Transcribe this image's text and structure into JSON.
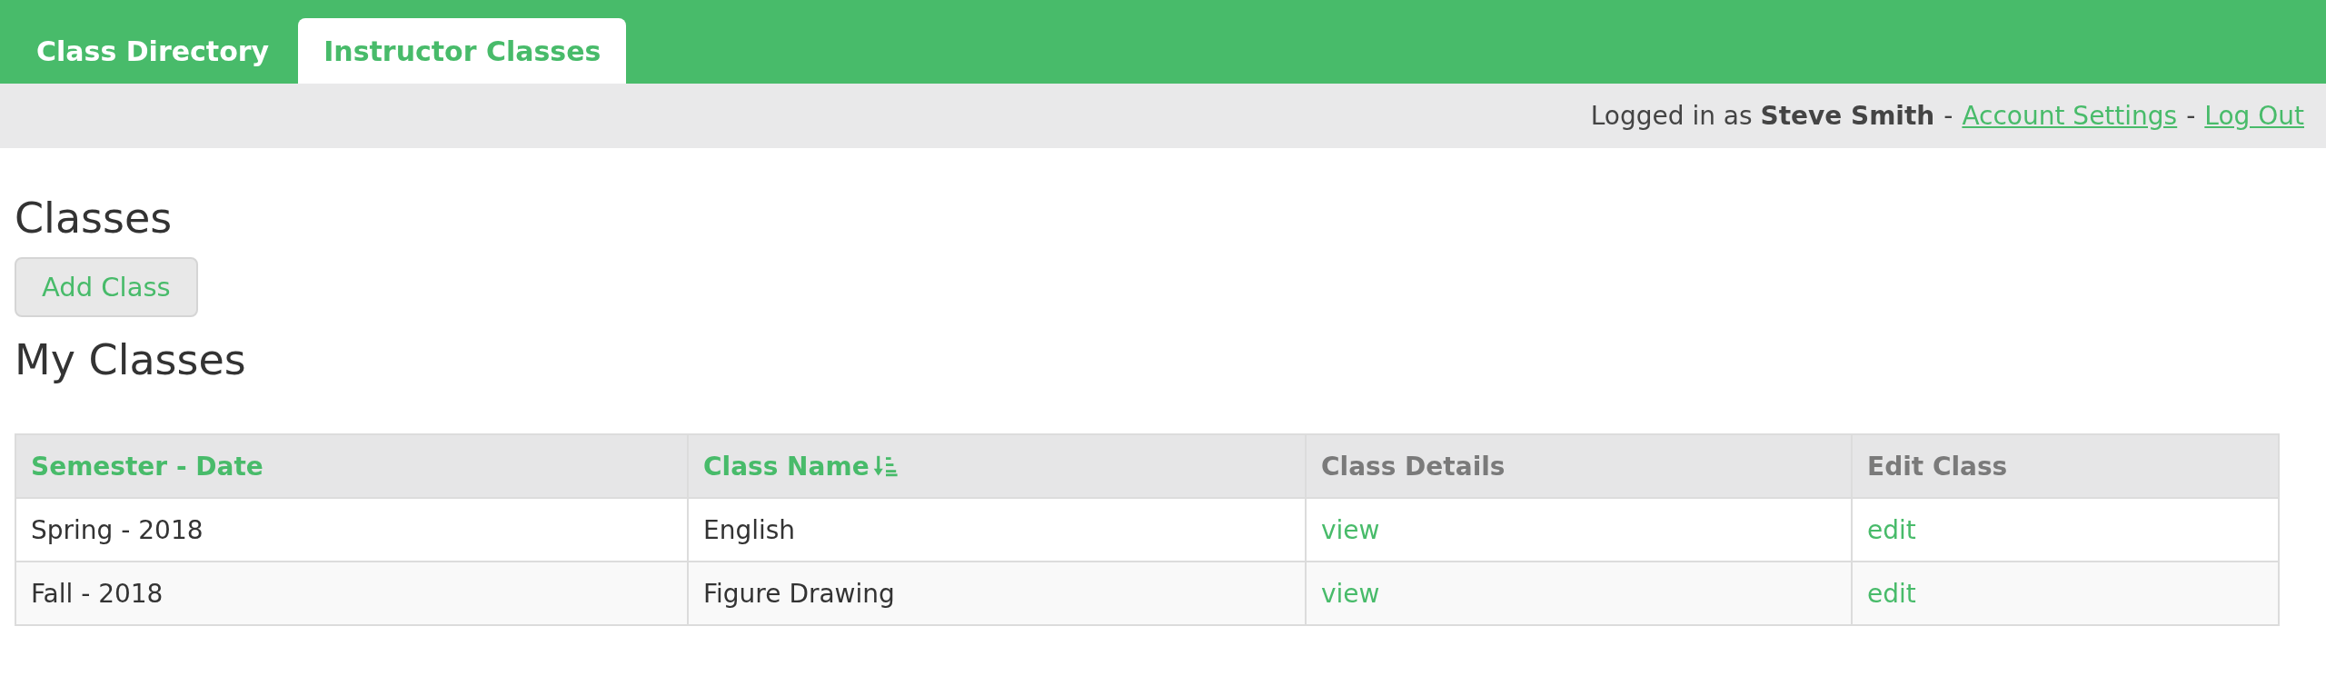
{
  "tabs": [
    {
      "label": "Class Directory",
      "selected": false
    },
    {
      "label": "Instructor Classes",
      "selected": true
    }
  ],
  "user_bar": {
    "prefix": "Logged in as",
    "user": "Steve Smith",
    "separator_1": "-",
    "account_link": "Account Settings",
    "separator_2": "-",
    "logout_link": "Log Out"
  },
  "heading": "Classes",
  "add_button": "Add Class",
  "subheading": "My Classes",
  "table": {
    "columns": [
      {
        "label": "Semester - Date",
        "sortable": true,
        "sorted": false
      },
      {
        "label": "Class Name",
        "sortable": true,
        "sorted": true
      },
      {
        "label": "Class Details",
        "sortable": false,
        "sorted": false
      },
      {
        "label": "Edit Class",
        "sortable": false,
        "sorted": false
      }
    ],
    "rows": [
      {
        "cells": [
          {
            "kind": "text",
            "text": "Spring - 2018"
          },
          {
            "kind": "text",
            "text": "English"
          },
          {
            "kind": "link",
            "text": "view"
          },
          {
            "kind": "link",
            "text": "edit"
          }
        ]
      },
      {
        "cells": [
          {
            "kind": "text",
            "text": "Fall - 2018"
          },
          {
            "kind": "text",
            "text": "Figure Drawing"
          },
          {
            "kind": "link",
            "text": "view"
          },
          {
            "kind": "link",
            "text": "edit"
          }
        ]
      }
    ]
  }
}
